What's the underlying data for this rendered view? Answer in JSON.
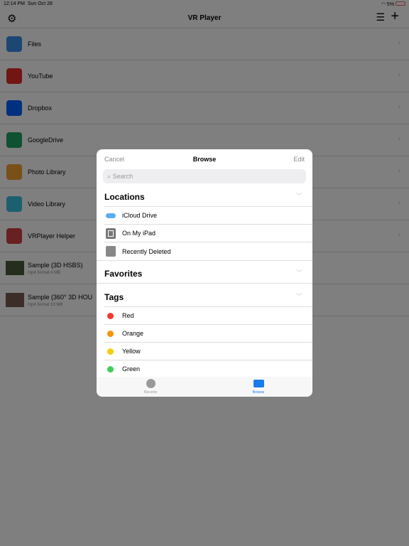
{
  "status": {
    "time": "12:14 PM",
    "date": "Sun Oct 28",
    "battery": "5%"
  },
  "nav": {
    "title": "VR Player"
  },
  "list": [
    {
      "label": "Files",
      "icon": "files-icon",
      "color": "#3a8ee6"
    },
    {
      "label": "YouTube",
      "icon": "youtube-icon",
      "color": "#e52d27"
    },
    {
      "label": "Dropbox",
      "icon": "dropbox-icon",
      "color": "#0061fe"
    },
    {
      "label": "GoogleDrive",
      "icon": "google-drive-icon",
      "color": "#1fa463"
    },
    {
      "label": "Photo Library",
      "icon": "camera-icon",
      "color": "#f0a030"
    },
    {
      "label": "Video Library",
      "icon": "video-camera-icon",
      "color": "#38c0e0"
    },
    {
      "label": "VRPlayer Helper",
      "icon": "helper-icon",
      "color": "#d04040"
    }
  ],
  "samples": [
    {
      "title": "Sample (3D HSBS)",
      "sub": "mp4 format 4 MB"
    },
    {
      "title": "Sample (360° 3D HOU",
      "sub": "mp4 format 10 MB"
    }
  ],
  "modal": {
    "cancel": "Cancel",
    "title": "Browse",
    "edit": "Edit",
    "search_placeholder": "Search",
    "locations": "Locations",
    "favorites": "Favorites",
    "tags": "Tags",
    "location_items": [
      "iCloud Drive",
      "On My iPad",
      "Recently Deleted"
    ],
    "tag_items": [
      {
        "label": "Red",
        "color": "#f03a2e"
      },
      {
        "label": "Orange",
        "color": "#f7920a"
      },
      {
        "label": "Yellow",
        "color": "#f7cc0a"
      },
      {
        "label": "Green",
        "color": "#3ecf55"
      }
    ],
    "tabs": {
      "recents": "Recents",
      "browse": "Browse"
    }
  }
}
